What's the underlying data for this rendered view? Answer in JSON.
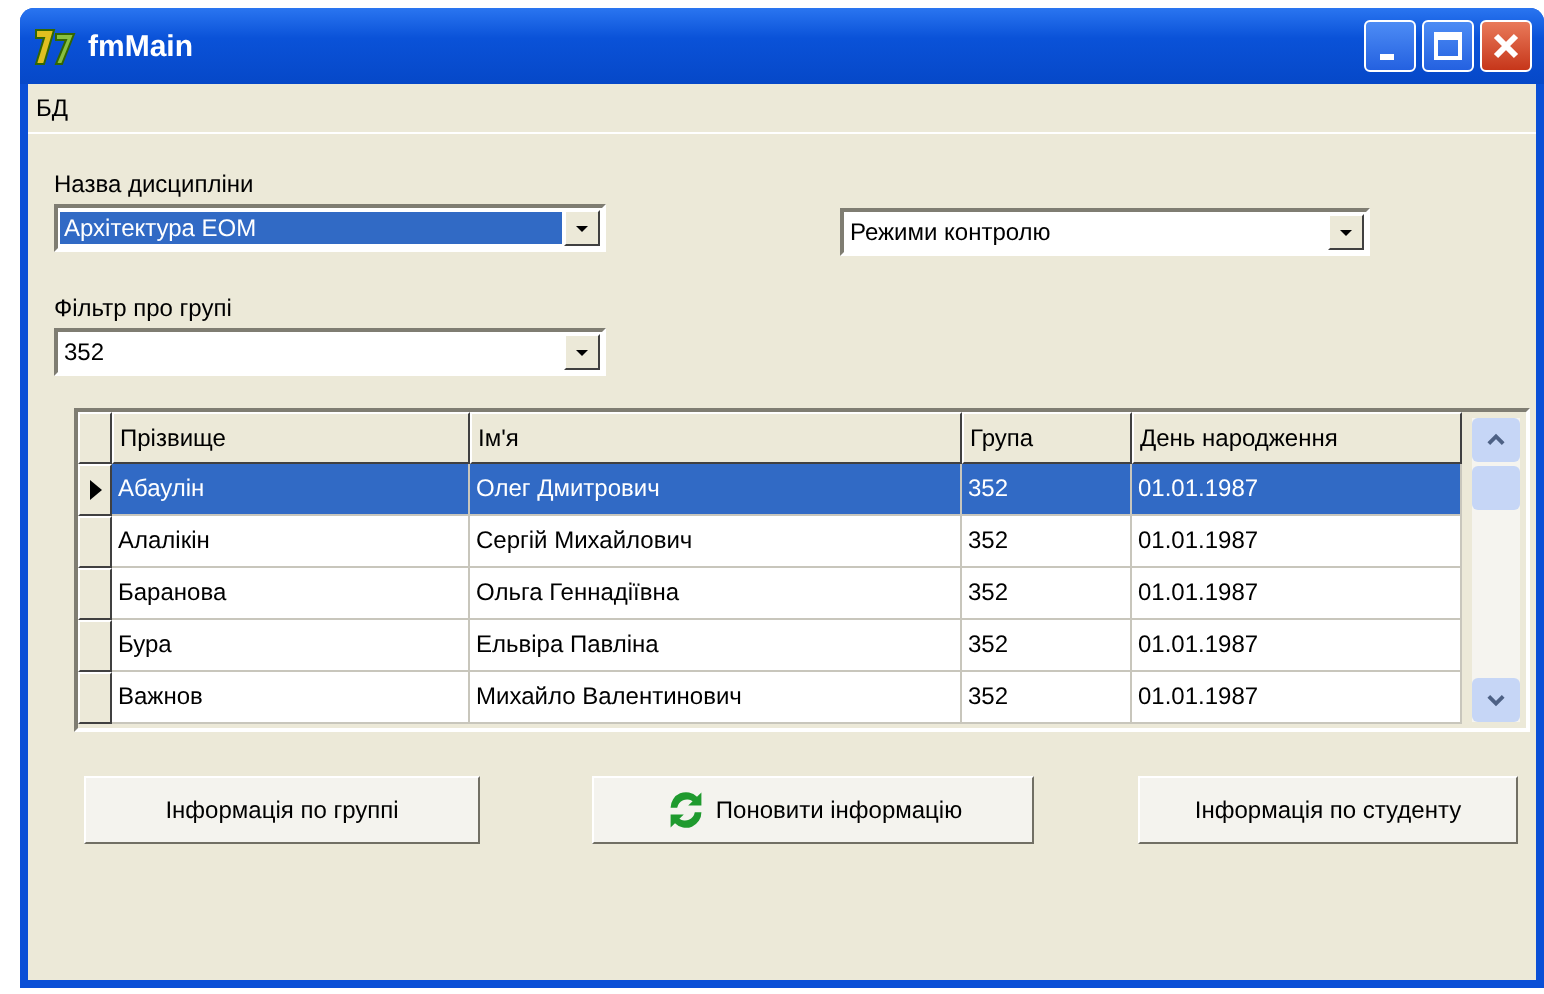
{
  "window": {
    "title": "fmMain"
  },
  "menu": [
    {
      "label": "БД"
    }
  ],
  "discipline": {
    "label": "Назва дисципліни",
    "value": "Архітектура ЕОМ",
    "focused": true
  },
  "control_mode": {
    "value": "Режими контролю",
    "focused": false
  },
  "group_filter": {
    "label": "Фільтр про групі",
    "value": "352",
    "focused": false
  },
  "table": {
    "columns": [
      "Прізвище",
      "Ім'я",
      "Група",
      "День народження"
    ],
    "rows": [
      {
        "cells": [
          "Абаулін",
          "Олег Дмитрович",
          "352",
          "01.01.1987"
        ],
        "selected": true
      },
      {
        "cells": [
          "Алалікін",
          "Сергій Михайлович",
          "352",
          "01.01.1987"
        ],
        "selected": false
      },
      {
        "cells": [
          "Баранова",
          "Ольга Геннадіївна",
          "352",
          "01.01.1987"
        ],
        "selected": false
      },
      {
        "cells": [
          "Бура",
          "Ельвіра Павліна",
          "352",
          "01.01.1987"
        ],
        "selected": false
      },
      {
        "cells": [
          "Важнов",
          "Михайло Валентинович",
          "352",
          "01.01.1987"
        ],
        "selected": false
      }
    ]
  },
  "buttons": [
    {
      "label": "Інформація по группі",
      "kind": "plain"
    },
    {
      "label": "Поновити інформацію",
      "kind": "refresh"
    },
    {
      "label": "Інформація по студенту",
      "kind": "plain"
    }
  ]
}
